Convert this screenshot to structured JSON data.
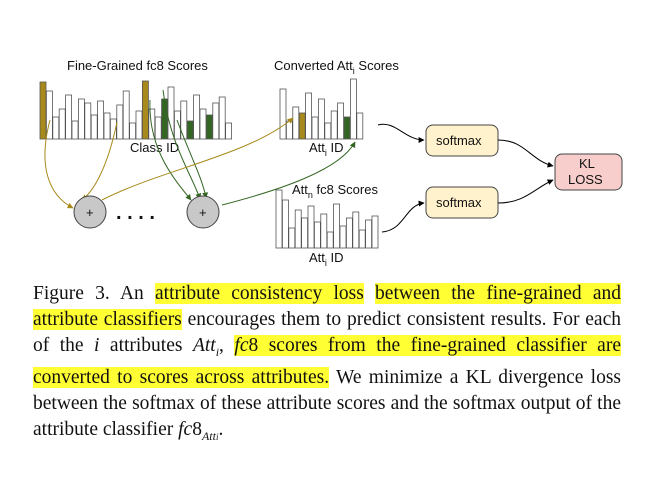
{
  "diagram": {
    "fine_grained_title": "Fine-Grained fc8 Scores",
    "converted_title_pre": "Converted Att",
    "converted_title_sub": "i",
    "converted_title_post": " Scores",
    "att_n_title_pre": "Att",
    "att_n_title_sub": "n",
    "att_n_title_post": " fc8 Scores",
    "class_id": "Class ID",
    "att_id_pre": "Att",
    "att_id_sub": "i",
    "att_id_post": " ID",
    "plus": "+",
    "ellipsis": ". . . .",
    "softmax_top": "softmax",
    "softmax_bottom": "softmax",
    "kl_line1": "KL",
    "kl_line2": "LOSS"
  },
  "caption": {
    "p1": "Figure 3. An ",
    "h1": "attribute consistency loss",
    "p2": " ",
    "h2": "between the fine-grained and attribute classifiers",
    "p3": " encourages them to predict consistent results. For each of the ",
    "i_var": "i",
    "p4": " attributes ",
    "att_i": "Att",
    "att_i_sub": "i",
    "p5": ", ",
    "h3a": "fc",
    "h3b": "8 scores from the fine-grained classifier are converted to scores across attributes.",
    "p6": " We minimize a KL divergence loss between the softmax of these attribute scores and the softmax output of the attribute classifier ",
    "fc8": "fc",
    "fc8_num": "8",
    "fc8_sub": "Att",
    "fc8_subsub": "i",
    "p7": "."
  },
  "colors": {
    "gold": "#a88a1c",
    "green": "#336622",
    "softmax_fill": "#fff2cc",
    "kl_fill": "#f8cecc",
    "plus_fill": "#c8c8c8",
    "highlight": "#ffff33"
  }
}
